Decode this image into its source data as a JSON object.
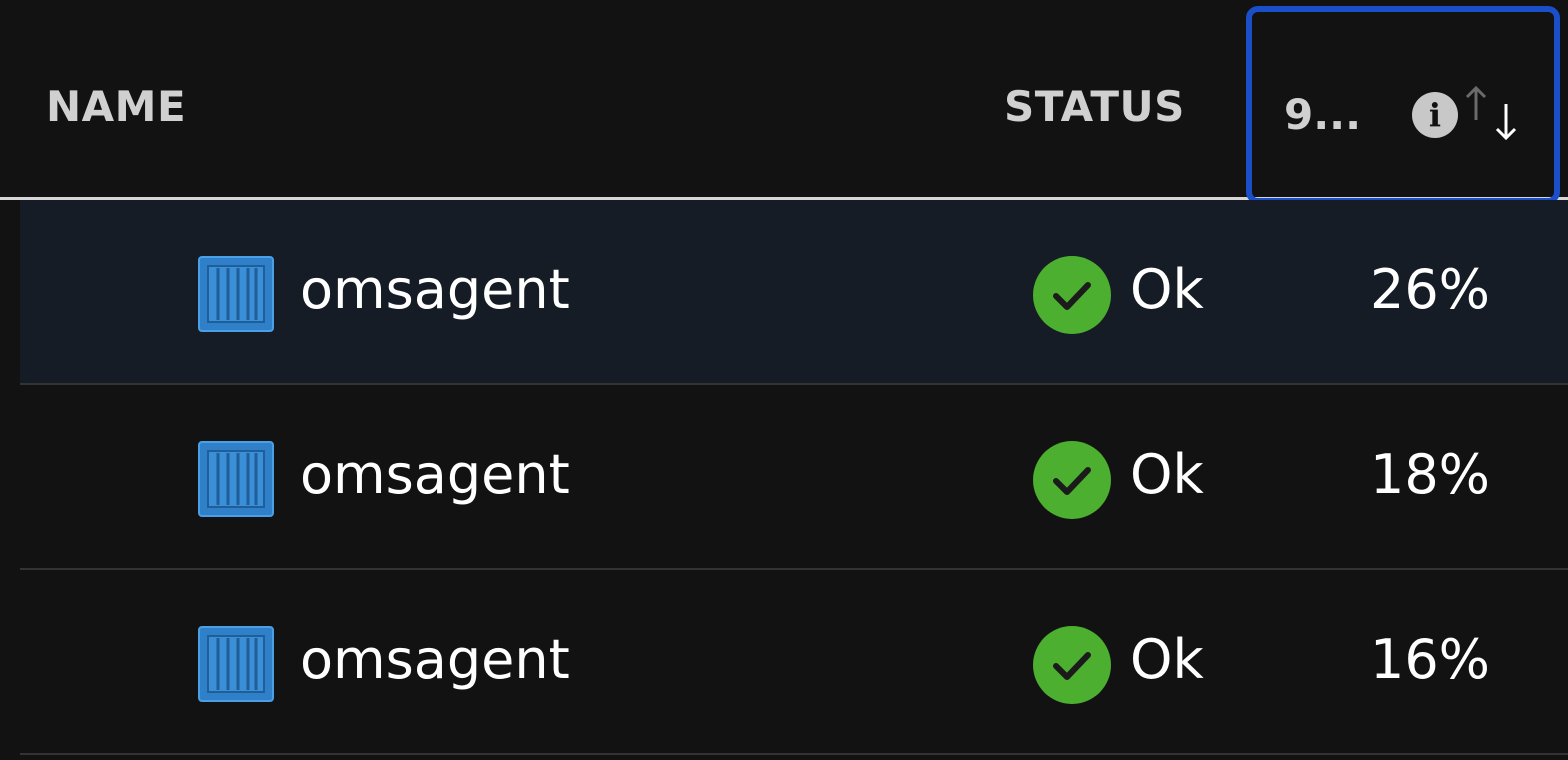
{
  "header": {
    "name_label": "NAME",
    "status_label": "STATUS",
    "metric_label": "9...",
    "info_icon_glyph": "i"
  },
  "rows": [
    {
      "name": "omsagent",
      "status": "Ok",
      "metric": "26%",
      "selected": true
    },
    {
      "name": "omsagent",
      "status": "Ok",
      "metric": "18%",
      "selected": false
    },
    {
      "name": "omsagent",
      "status": "Ok",
      "metric": "16%",
      "selected": false
    }
  ],
  "icons": {
    "container": "container-icon",
    "status_ok": "status-ok-icon",
    "info": "info-icon",
    "sort": "sort-icon"
  },
  "colors": {
    "background": "#121212",
    "selected_row": "#151c25",
    "focus_border": "#1a4fc9",
    "status_ok": "#4caf2f",
    "container_blue": "#3a8fd6"
  }
}
